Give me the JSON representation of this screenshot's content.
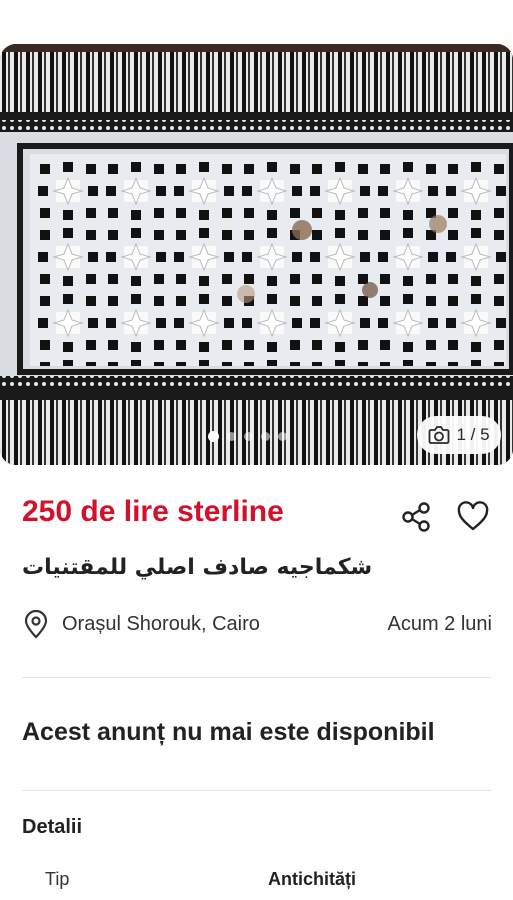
{
  "gallery": {
    "image_description_icon": "inlaid-wooden-box-photo",
    "counter": "1 / 5",
    "total_images": 5,
    "current_image": 1
  },
  "listing": {
    "price": "250 de lire sterline",
    "title": "شكماجيه صادف اصلي للمقتنيات",
    "location": "Orașul Shorouk, Cairo",
    "posted": "Acum 2 luni",
    "status": "Acest anunț nu mai este disponibil"
  },
  "details": {
    "heading": "Detalii",
    "rows": [
      {
        "key": "Tip",
        "value": "Antichități"
      }
    ]
  },
  "colors": {
    "price": "#d4102a",
    "divider": "#e6e6e6"
  }
}
